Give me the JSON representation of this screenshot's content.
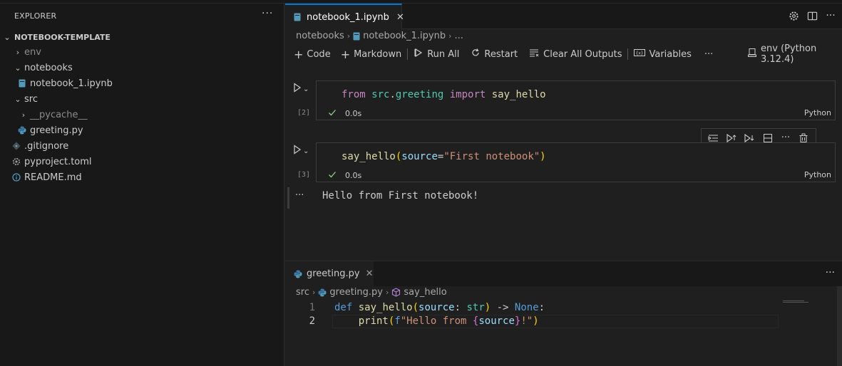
{
  "explorer": {
    "title": "EXPLORER",
    "more": "···",
    "root": "NOTEBOOK-TEMPLATE",
    "items": [
      {
        "label": "env",
        "kind": "folder",
        "collapsed": true
      },
      {
        "label": "notebooks",
        "kind": "folder",
        "collapsed": false
      },
      {
        "label": "notebook_1.ipynb",
        "kind": "notebook"
      },
      {
        "label": "src",
        "kind": "folder",
        "collapsed": false
      },
      {
        "label": "__pycache__",
        "kind": "folder",
        "collapsed": true
      },
      {
        "label": "greeting.py",
        "kind": "python"
      },
      {
        "label": ".gitignore",
        "kind": "git"
      },
      {
        "label": "pyproject.toml",
        "kind": "settings"
      },
      {
        "label": "README.md",
        "kind": "info"
      }
    ]
  },
  "editor": {
    "tab": {
      "label": "notebook_1.ipynb",
      "close": "✕"
    },
    "breadcrumb": {
      "folder": "notebooks",
      "file": "notebook_1.ipynb",
      "more": "..."
    }
  },
  "toolbar": {
    "code": "Code",
    "markdown": "Markdown",
    "run_all": "Run All",
    "restart": "Restart",
    "clear_outputs": "Clear All Outputs",
    "variables": "Variables",
    "more": "···",
    "kernel": "env (Python 3.12.4)"
  },
  "cells": [
    {
      "exec_count": "[2]",
      "code_parts": [
        "from",
        " src",
        ".",
        "greeting",
        " import",
        " say_hello"
      ],
      "duration": "0.0s",
      "language": "Python"
    },
    {
      "exec_count": "[3]",
      "code_parts": [
        "say_hello",
        "(",
        "source",
        "=",
        "\"First notebook\"",
        ")"
      ],
      "duration": "0.0s",
      "language": "Python",
      "output": "Hello from First notebook!",
      "output_more": "···"
    }
  ],
  "cell_toolbar": {
    "more": "···"
  },
  "bottom_editor": {
    "tab": {
      "label": "greeting.py",
      "close": "✕"
    },
    "more": "···",
    "breadcrumb": {
      "folder": "src",
      "file": "greeting.py",
      "symbol": "say_hello"
    },
    "lines": [
      {
        "no": "1",
        "parts": [
          "def",
          " say_hello",
          "(",
          "source",
          ":",
          " str",
          ")",
          " ->",
          " None",
          ":"
        ]
      },
      {
        "no": "2",
        "parts": [
          "    ",
          "print",
          "(",
          "f",
          "\"Hello from ",
          "{",
          "source",
          "}",
          "!\"",
          ")"
        ]
      }
    ]
  },
  "colors": {
    "accent": "#0078d4",
    "keyword": "#c586c0",
    "function": "#dcdcaa",
    "string": "#ce9178",
    "check": "#89d185"
  }
}
